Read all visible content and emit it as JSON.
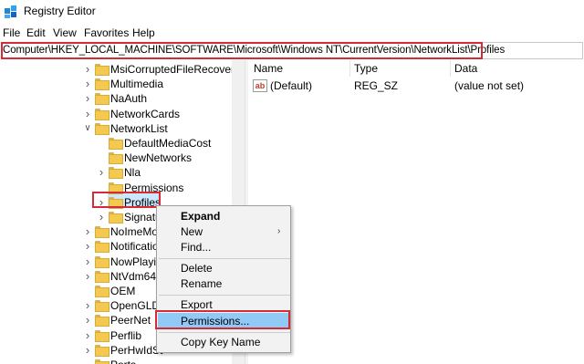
{
  "window": {
    "title": "Registry Editor",
    "icon": "registry-editor-icon"
  },
  "menu": [
    "File",
    "Edit",
    "View",
    "Favorites",
    "Help"
  ],
  "address": {
    "path": "Computer\\HKEY_LOCAL_MACHINE\\SOFTWARE\\Microsoft\\Windows NT\\CurrentVersion\\NetworkList\\Profiles"
  },
  "tree": {
    "items": [
      {
        "label": "MsiCorruptedFileRecovery",
        "expander": "collapsed",
        "level": 0
      },
      {
        "label": "Multimedia",
        "expander": "collapsed",
        "level": 0
      },
      {
        "label": "NaAuth",
        "expander": "collapsed",
        "level": 0
      },
      {
        "label": "NetworkCards",
        "expander": "collapsed",
        "level": 0
      },
      {
        "label": "NetworkList",
        "expander": "expanded",
        "level": 0
      },
      {
        "label": "DefaultMediaCost",
        "expander": "none",
        "level": 1
      },
      {
        "label": "NewNetworks",
        "expander": "none",
        "level": 1
      },
      {
        "label": "Nla",
        "expander": "collapsed",
        "level": 1
      },
      {
        "label": "Permissions",
        "expander": "none",
        "level": 1
      },
      {
        "label": "Profiles",
        "expander": "collapsed",
        "level": 1,
        "selected": true
      },
      {
        "label": "Signatu",
        "expander": "collapsed",
        "level": 1
      },
      {
        "label": "NoImeMo",
        "expander": "collapsed",
        "level": 0
      },
      {
        "label": "Notificatio",
        "expander": "collapsed",
        "level": 0
      },
      {
        "label": "NowPlayin",
        "expander": "collapsed",
        "level": 0
      },
      {
        "label": "NtVdm64",
        "expander": "collapsed",
        "level": 0
      },
      {
        "label": "OEM",
        "expander": "none",
        "level": 0
      },
      {
        "label": "OpenGLDr",
        "expander": "collapsed",
        "level": 0
      },
      {
        "label": "PeerNet",
        "expander": "collapsed",
        "level": 0
      },
      {
        "label": "Perflib",
        "expander": "collapsed",
        "level": 0
      },
      {
        "label": "PerHwIdSt",
        "expander": "collapsed",
        "level": 0
      },
      {
        "label": "Ports",
        "expander": "none",
        "level": 0
      }
    ]
  },
  "values_pane": {
    "headers": {
      "name": "Name",
      "type": "Type",
      "data": "Data"
    },
    "rows": [
      {
        "name": "(Default)",
        "type": "REG_SZ",
        "data": "(value not set)",
        "icon": "string-value-icon",
        "icon_text": "ab"
      }
    ]
  },
  "context_menu": {
    "items": [
      {
        "label": "Expand",
        "bold": true
      },
      {
        "label": "New",
        "submenu": true
      },
      {
        "label": "Find..."
      },
      {
        "label": "Delete"
      },
      {
        "label": "Rename"
      },
      {
        "label": "Export"
      },
      {
        "label": "Permissions...",
        "highlighted": true
      },
      {
        "label": "Copy Key Name"
      }
    ]
  },
  "colors": {
    "highlight_box": "#d52b35",
    "selection": "#cce8ff",
    "menu_hover": "#91c9f7",
    "folder": "#f3c94f"
  }
}
